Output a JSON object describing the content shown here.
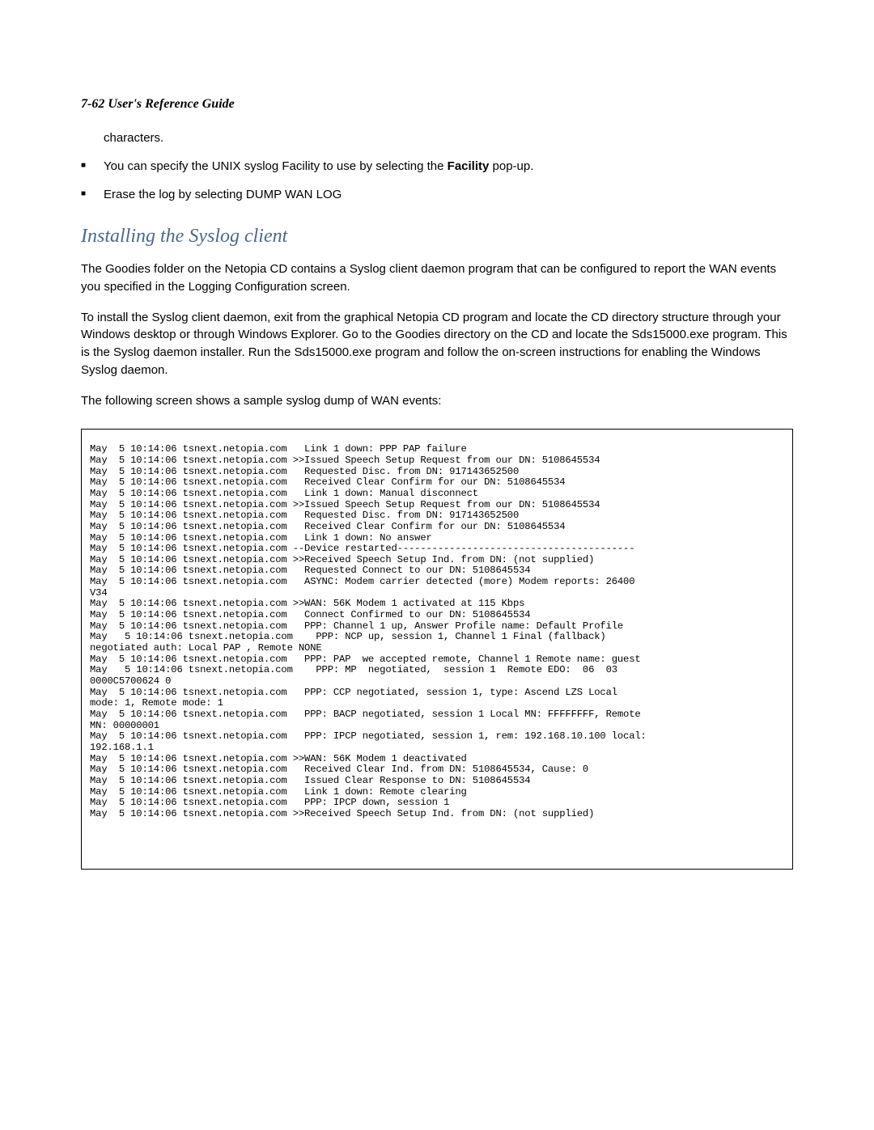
{
  "header": {
    "page_label": "7-62  User's Reference Guide"
  },
  "intro": {
    "continued_line": "characters.",
    "bullets": [
      {
        "pre": "You can specify the UNIX syslog Facility to use by selecting the ",
        "bold": "Facility",
        "post": " pop-up."
      },
      {
        "pre": "Erase the log by selecting DUMP WAN LOG",
        "bold": "",
        "post": ""
      }
    ]
  },
  "section": {
    "heading": "Installing the Syslog client",
    "para1": "The Goodies folder on the Netopia CD contains a Syslog client daemon program that can be configured to report the WAN events you specified in the Logging Configuration screen.",
    "para2": "To install the Syslog client daemon, exit from the graphical Netopia CD program and locate the CD directory structure through your Windows desktop or through Windows Explorer. Go to the Goodies directory on the CD and locate the Sds15000.exe program. This is the Syslog daemon installer. Run the Sds15000.exe program and follow the on-screen instructions for enabling the Windows Syslog daemon.",
    "para3": "The following screen shows a sample syslog dump of WAN events:"
  },
  "syslog": {
    "dump": "May  5 10:14:06 tsnext.netopia.com   Link 1 down: PPP PAP failure\nMay  5 10:14:06 tsnext.netopia.com >>Issued Speech Setup Request from our DN: 5108645534\nMay  5 10:14:06 tsnext.netopia.com   Requested Disc. from DN: 917143652500\nMay  5 10:14:06 tsnext.netopia.com   Received Clear Confirm for our DN: 5108645534\nMay  5 10:14:06 tsnext.netopia.com   Link 1 down: Manual disconnect\nMay  5 10:14:06 tsnext.netopia.com >>Issued Speech Setup Request from our DN: 5108645534\nMay  5 10:14:06 tsnext.netopia.com   Requested Disc. from DN: 917143652500\nMay  5 10:14:06 tsnext.netopia.com   Received Clear Confirm for our DN: 5108645534\nMay  5 10:14:06 tsnext.netopia.com   Link 1 down: No answer\nMay  5 10:14:06 tsnext.netopia.com --Device restarted-----------------------------------------\nMay  5 10:14:06 tsnext.netopia.com >>Received Speech Setup Ind. from DN: (not supplied)\nMay  5 10:14:06 tsnext.netopia.com   Requested Connect to our DN: 5108645534\nMay  5 10:14:06 tsnext.netopia.com   ASYNC: Modem carrier detected (more) Modem reports: 26400\nV34\nMay  5 10:14:06 tsnext.netopia.com >>WAN: 56K Modem 1 activated at 115 Kbps\nMay  5 10:14:06 tsnext.netopia.com   Connect Confirmed to our DN: 5108645534\nMay  5 10:14:06 tsnext.netopia.com   PPP: Channel 1 up, Answer Profile name: Default Profile\nMay   5 10:14:06 tsnext.netopia.com    PPP: NCP up, session 1, Channel 1 Final (fallback)\nnegotiated auth: Local PAP , Remote NONE\nMay  5 10:14:06 tsnext.netopia.com   PPP: PAP  we accepted remote, Channel 1 Remote name: guest\nMay   5 10:14:06 tsnext.netopia.com    PPP: MP  negotiated,  session 1  Remote EDO:  06  03\n0000C5700624 0\nMay  5 10:14:06 tsnext.netopia.com   PPP: CCP negotiated, session 1, type: Ascend LZS Local\nmode: 1, Remote mode: 1\nMay  5 10:14:06 tsnext.netopia.com   PPP: BACP negotiated, session 1 Local MN: FFFFFFFF, Remote\nMN: 00000001\nMay  5 10:14:06 tsnext.netopia.com   PPP: IPCP negotiated, session 1, rem: 192.168.10.100 local:\n192.168.1.1\nMay  5 10:14:06 tsnext.netopia.com >>WAN: 56K Modem 1 deactivated\nMay  5 10:14:06 tsnext.netopia.com   Received Clear Ind. from DN: 5108645534, Cause: 0\nMay  5 10:14:06 tsnext.netopia.com   Issued Clear Response to DN: 5108645534\nMay  5 10:14:06 tsnext.netopia.com   Link 1 down: Remote clearing\nMay  5 10:14:06 tsnext.netopia.com   PPP: IPCP down, session 1\nMay  5 10:14:06 tsnext.netopia.com >>Received Speech Setup Ind. from DN: (not supplied)"
  }
}
